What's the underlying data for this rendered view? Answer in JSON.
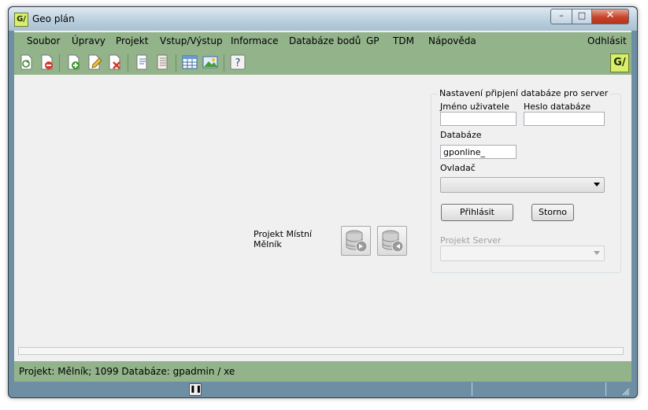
{
  "window": {
    "title": "Geo plán",
    "app_icon": "G/"
  },
  "menu": [
    "Soubor",
    "Úpravy",
    "Projekt",
    "Vstup/Výstup",
    "Informace",
    "Databáze bodů",
    "GP",
    "TDM",
    "Nápověda"
  ],
  "menu_right": "Odhlásit",
  "toolbar_icons": [
    "refresh-document-icon",
    "remove-document-icon",
    "new-document-icon",
    "edit-document-icon",
    "delete-document-icon",
    "properties-icon",
    "list-icon",
    "table-icon",
    "image-icon",
    "help-icon"
  ],
  "brand_logo": "G/",
  "project": {
    "line1": "Projekt Místní",
    "line2": "Mělník"
  },
  "db_form": {
    "legend": "Nastavení připjení databáze pro server",
    "user_label": "Jméno uživatele",
    "user_value": "",
    "password_label": "Heslo databáze",
    "password_value": "",
    "database_label": "Databáze",
    "database_value": "gponline_",
    "driver_label": "Ovladač",
    "driver_value": "",
    "login_button": "Přihlásit",
    "cancel_button": "Storno",
    "project_server_label": "Projekt Server",
    "project_server_value": ""
  },
  "status": {
    "text": "Projekt: Mělník; 1099  Databáze: gpadmin / xe"
  },
  "colors": {
    "bar_green": "#93b38b",
    "frame_blue": "#6e8fa3",
    "logo_lime": "#d9ef6b",
    "close_red": "#c7432a"
  }
}
